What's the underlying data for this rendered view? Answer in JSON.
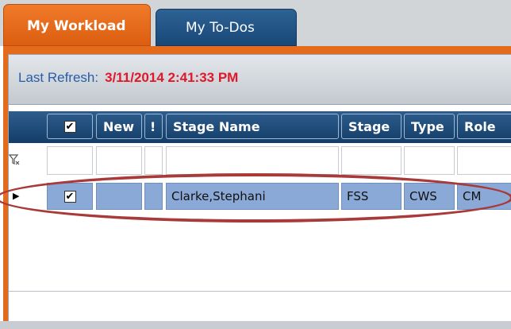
{
  "tabs": [
    {
      "label": "My Workload",
      "active": true
    },
    {
      "label": "My To-Dos",
      "active": false
    }
  ],
  "refresh": {
    "label": "Last Refresh:",
    "value": "3/11/2014 2:41:33 PM"
  },
  "grid": {
    "columns": [
      {
        "key": "select",
        "label": ""
      },
      {
        "key": "new",
        "label": "New"
      },
      {
        "key": "flag",
        "label": "!"
      },
      {
        "key": "stage_name",
        "label": "Stage Name"
      },
      {
        "key": "stage",
        "label": "Stage"
      },
      {
        "key": "type",
        "label": "Type"
      },
      {
        "key": "role",
        "label": "Role"
      }
    ],
    "header_checkbox": "✔",
    "filter_icon": "funnel-clear-icon",
    "rows": [
      {
        "selected": "✔",
        "new": "",
        "flag": "",
        "stage_name": "Clarke,Stephani",
        "stage": "FSS",
        "type": "CWS",
        "role": "CM"
      }
    ]
  },
  "colors": {
    "active_tab": "#e46a1c",
    "inactive_tab": "#1f4f80",
    "header": "#1e4a78",
    "refresh_label": "#2a5caa",
    "refresh_value": "#e0182a",
    "selected_row": "#8aa9d6",
    "annotation": "#a83a3a"
  }
}
